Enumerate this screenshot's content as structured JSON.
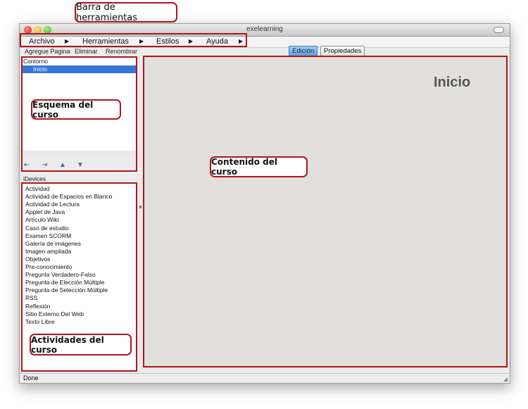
{
  "callouts": {
    "toolbar": "Barra de herramientas",
    "outline": "Esquema del curso",
    "content": "Contenido del curso",
    "activities": "Actividades del curso"
  },
  "window": {
    "title": "exelearning"
  },
  "menu": {
    "items": [
      "Archivo",
      "Herramientas",
      "Estilos",
      "Ayuda"
    ],
    "arrow": "▶"
  },
  "toolbar": {
    "add_page": "Agregue Pagina",
    "delete": "Eliminar",
    "rename": "Renombrar"
  },
  "tabs": {
    "edit": "Edición",
    "properties": "Propiedades"
  },
  "outline": {
    "header": "Contorno",
    "nodes": [
      "Inicio"
    ]
  },
  "idevices": {
    "header": "iDevices",
    "items": [
      "Actividad",
      "Actividad de Espacios en Blanco",
      "Actividad de Lectura",
      "Applet de Java",
      "Artículo Wiki",
      "Caso de estudio",
      "Examen SCORM",
      "Galería de imágenes",
      "Imagen ampliada",
      "Objetivos",
      "Pre-conocimiento",
      "Pregunta Verdadero-Falso",
      "Pregunta de Elección Múltiple",
      "Pregunta de Selección Múltiple",
      "RSS",
      "Reflexión",
      "Sitio Externo Del Web",
      "Texto Libre"
    ]
  },
  "content": {
    "page_title": "Inicio"
  },
  "status": {
    "text": "Done"
  },
  "colors": {
    "accent": "#b0151d",
    "selection": "#3875d7",
    "content_bg": "#e1e0dc"
  }
}
